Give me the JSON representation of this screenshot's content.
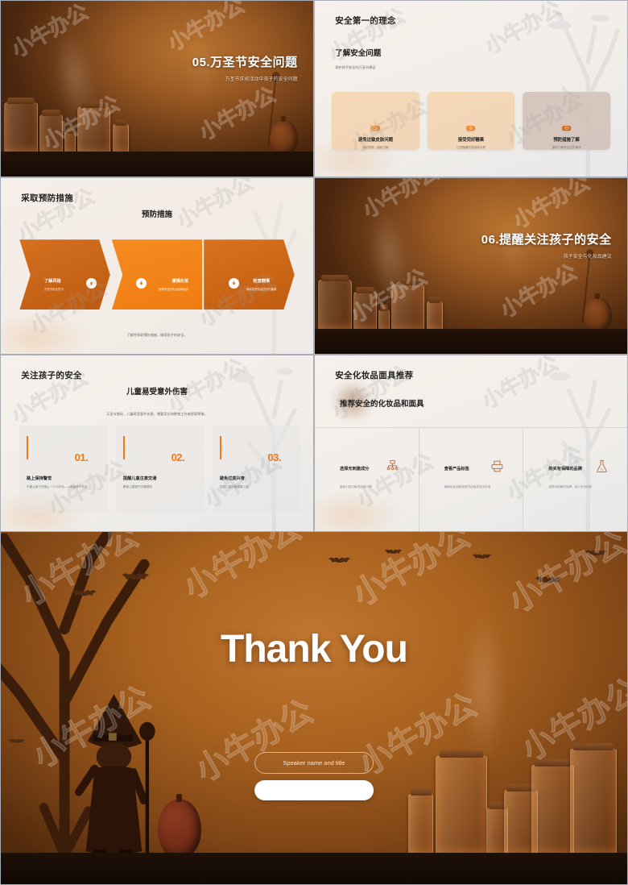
{
  "deck": {
    "watermark": "小牛办公",
    "accent": "#ef7c12",
    "dark_bg": "#9a5a24",
    "light_bg": "#f3eee9"
  },
  "slides": {
    "s1": {
      "title": "05.万圣节安全问题",
      "subtitle": "万圣节庆祝活动中孩子的安全问题"
    },
    "s2": {
      "title": "安全第一的理念",
      "heading": "了解安全问题",
      "desc": "保护孩子安全的万圣节建议",
      "cards": [
        {
          "icon": "folder-icon",
          "title": "避免过敏皮肤问题",
          "desc": "保护肌肤，避免过敏"
        },
        {
          "icon": "target-icon",
          "title": "接受完好糖果",
          "desc": "注意糖果的质量和对策"
        },
        {
          "icon": "card-icon",
          "title": "预防措施了解",
          "desc": "提前了解安全注意事项"
        }
      ]
    },
    "s3": {
      "title": "采取预防措施",
      "heading": "预防措施",
      "arrows": [
        {
          "title": "了解风险",
          "desc": "万圣节安全意识",
          "icon": "arrow-up-icon"
        },
        {
          "title": "谨慎化妆",
          "desc": "推荐安全的化妆品和面具",
          "icon": "arrow-down-icon"
        },
        {
          "title": "检查糖果",
          "desc": "确保接受包装完好的糖果",
          "icon": "arrow-down-icon"
        }
      ],
      "footer": "了解并采取预防措施，确保孩子的安全。"
    },
    "s4": {
      "title": "06.提醒关注孩子的安全",
      "subtitle": "孩子安全与化妆品建议"
    },
    "s5": {
      "title": "关注孩子的安全",
      "heading": "儿童易受意外伤害",
      "desc": "万圣节期间，儿童易受意外伤害，需要家长和教育工作者提高警惕。",
      "cards": [
        {
          "number": "01.",
          "title": "路上保持警觉",
          "desc": "不要让孩子在晚上一个人外出——确保孩子安全"
        },
        {
          "number": "02.",
          "title": "提醒儿童注意交通",
          "desc": "教育儿童遵守交通规则"
        },
        {
          "number": "03.",
          "title": "避免过度兴奋",
          "desc": "控制儿童的糖果摄入量"
        }
      ]
    },
    "s6": {
      "title": "安全化妆品面具推荐",
      "heading": "推荐安全的化妆品和面具",
      "columns": [
        {
          "title": "选择无刺激成分",
          "desc": "避免引发过敏或皮肤问题",
          "icon": "hierarchy-icon"
        },
        {
          "title": "查看产品标签",
          "desc": "确保化妆品和面具符合相关安全标准",
          "icon": "printer-icon"
        },
        {
          "title": "购买有保障的品牌",
          "desc": "选择可信赖的品牌，减少安全风险",
          "icon": "flask-icon"
        }
      ]
    },
    "thanks": {
      "title": "Thank You",
      "speaker_placeholder": "Speaker name and title"
    }
  }
}
